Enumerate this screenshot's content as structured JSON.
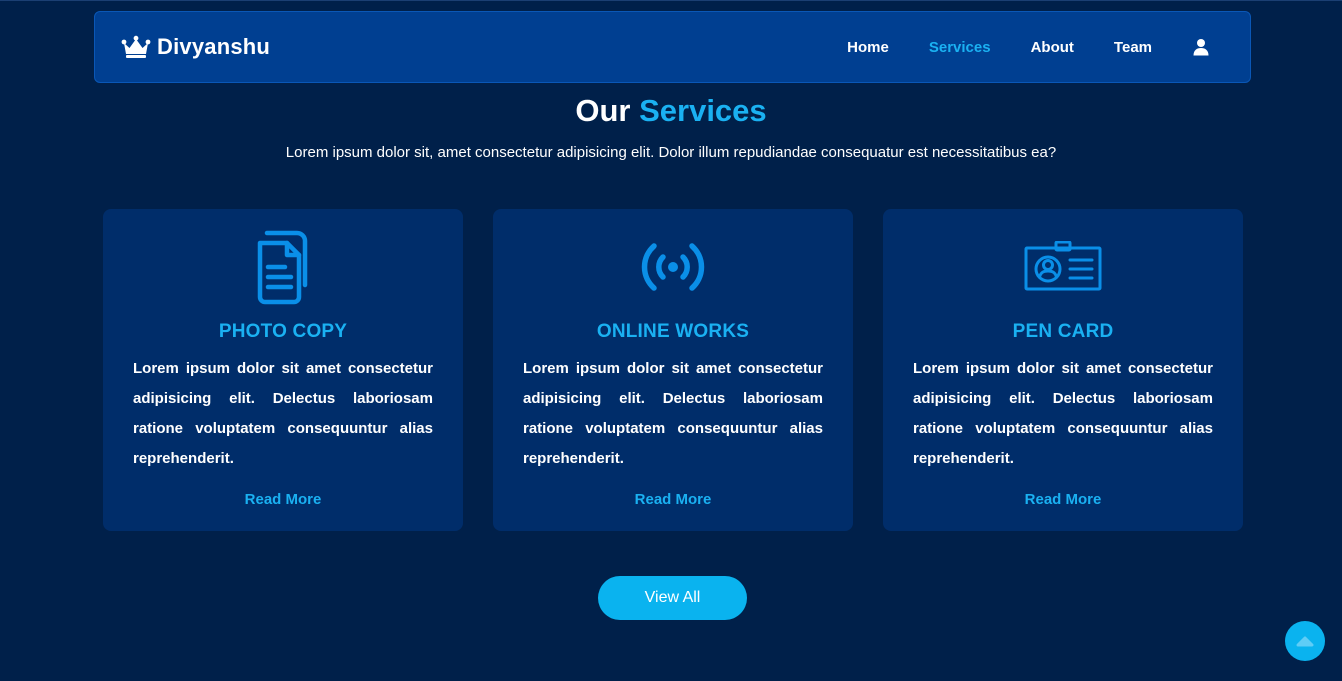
{
  "navbar": {
    "brand_name": "Divyanshu",
    "brand_icon": "crown-icon",
    "links": [
      {
        "label": "Home",
        "active": false
      },
      {
        "label": "Services",
        "active": true
      },
      {
        "label": "About",
        "active": false
      },
      {
        "label": "Team",
        "active": false
      }
    ],
    "user_icon": "user-icon"
  },
  "section": {
    "title_plain": "Our",
    "title_accent": "Services",
    "subtitle": "Lorem ipsum dolor sit, amet consectetur adipisicing elit. Dolor illum repudiandae consequatur est necessitatibus ea?"
  },
  "cards": [
    {
      "icon": "document-copy-icon",
      "title": "Photo Copy",
      "text": "Lorem ipsum dolor sit amet consectetur adipisicing elit. Delectus laboriosam ratione voluptatem consequuntur alias reprehenderit.",
      "link": "Read More"
    },
    {
      "icon": "broadcast-icon",
      "title": "Online Works",
      "text": "Lorem ipsum dolor sit amet consectetur adipisicing elit. Delectus laboriosam ratione voluptatem consequuntur alias reprehenderit.",
      "link": "Read More"
    },
    {
      "icon": "id-card-icon",
      "title": "Pen Card",
      "text": "Lorem ipsum dolor sit amet consectetur adipisicing elit. Delectus laboriosam ratione voluptatem consequuntur alias reprehenderit.",
      "link": "Read More"
    }
  ],
  "view_all_label": "View All",
  "scroll_top_icon": "chevron-up-icon",
  "colors": {
    "background": "#00204a",
    "navbar": "#003f91",
    "card": "#002d6a",
    "accent": "#1ab1f2",
    "icon": "#0a8fe8",
    "button": "#0ab3ef"
  }
}
